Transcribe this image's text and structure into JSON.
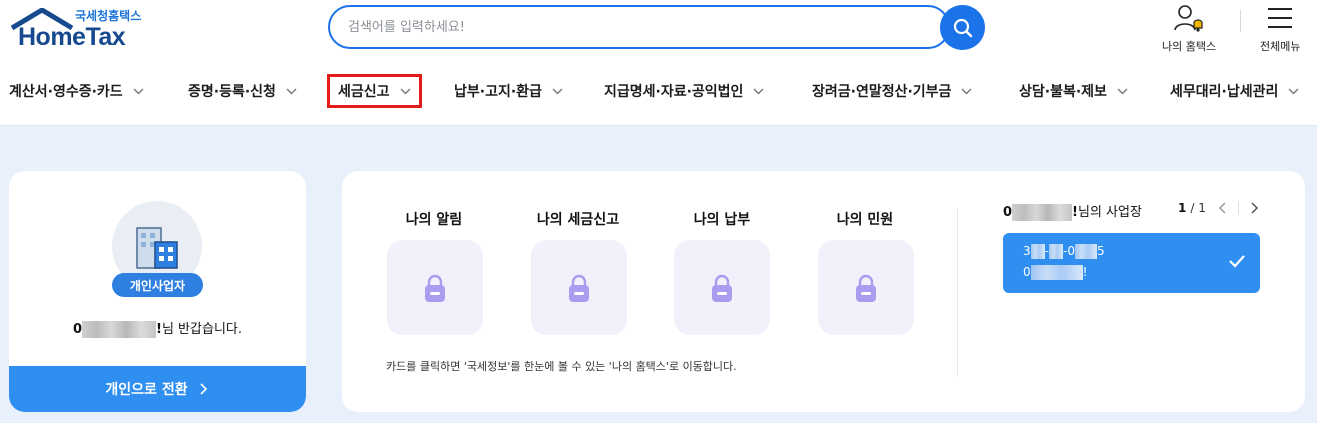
{
  "logo": {
    "sub": "국세청홈택스",
    "main": "HomeTax"
  },
  "search": {
    "placeholder": "검색어를 입력하세요!"
  },
  "util": {
    "my_hometax": "나의 홈택스",
    "all_menu": "전체메뉴"
  },
  "nav": {
    "items": [
      {
        "label": "계산서·영수증·카드"
      },
      {
        "label": "증명·등록·신청"
      },
      {
        "label": "세금신고"
      },
      {
        "label": "납부·고지·환급"
      },
      {
        "label": "지급명세·자료·공익법인"
      },
      {
        "label": "장려금·연말정산·기부금"
      },
      {
        "label": "상담·불복·제보"
      },
      {
        "label": "세무대리·납세관리"
      }
    ]
  },
  "profile": {
    "badge": "개인사업자",
    "name_start": "0",
    "name_end": "!",
    "greeting_suffix": "님 반갑습니다.",
    "switch_label": "개인으로 전환"
  },
  "dashboard": {
    "tiles": [
      {
        "title": "나의 알림"
      },
      {
        "title": "나의 세금신고"
      },
      {
        "title": "나의 납부"
      },
      {
        "title": "나의 민원"
      }
    ],
    "note": "카드를 클릭하면 '국세정보'를 한눈에 볼 수 있는 '나의 홈택스'로 이동합니다."
  },
  "business": {
    "owner_start": "0",
    "owner_end": "!",
    "header_suffix": "님의 사업장",
    "page_current": "1",
    "page_total": "/ 1",
    "reg_no_start": "3",
    "reg_no_mid1": "-",
    "reg_no_mid2": "-0",
    "reg_no_end": "5",
    "biz_name_start": "0",
    "biz_name_end": "!"
  },
  "colors": {
    "primary": "#1a73e8",
    "highlight": "#e31b1b",
    "tile_bg": "#f1f0fb",
    "lock": "#a99df0",
    "page_bg": "#e8f1fb"
  }
}
